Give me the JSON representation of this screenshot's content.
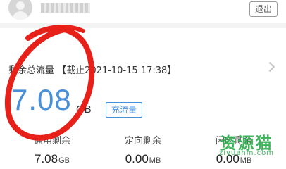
{
  "header": {
    "logout_label": "退出"
  },
  "summary": {
    "label": "剩余总流量 【截止2021-10-15 17:38】",
    "total_value": "7.08",
    "total_unit": "GB",
    "recharge_label": "充流量"
  },
  "stats": [
    {
      "label": "通用剩余",
      "value": "7.08",
      "unit": "GB"
    },
    {
      "label": "定向剩余",
      "value": "0.00",
      "unit": "MB"
    },
    {
      "label": "闲时剩余",
      "value": "0.00",
      "unit": "MB"
    }
  ],
  "watermark": {
    "text": "资源猫",
    "sub": "ziyuanm.com"
  },
  "colors": {
    "accent": "#4a90d9",
    "annotation": "#e8201a",
    "watermark": "#2eaf4f"
  }
}
